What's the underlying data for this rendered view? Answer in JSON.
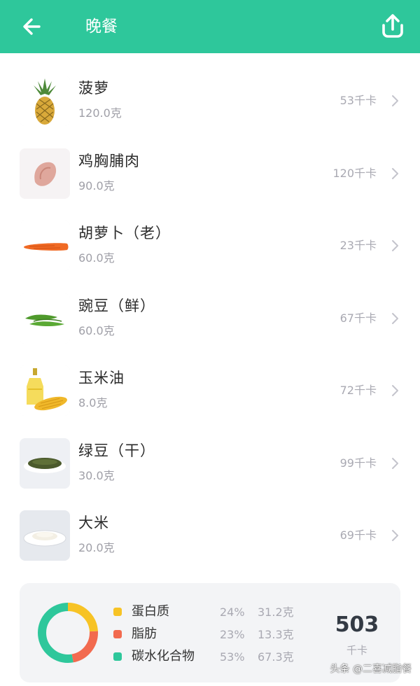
{
  "header": {
    "title": "晚餐",
    "bg_color": "#2ec79b",
    "back_icon": "arrow-left-icon",
    "share_icon": "share-upload-icon"
  },
  "foods": [
    {
      "name": "菠萝",
      "amount": "120.0克",
      "kcal": "53千卡",
      "image": "pineapple"
    },
    {
      "name": "鸡胸脯肉",
      "amount": "90.0克",
      "kcal": "120千卡",
      "image": "chicken-breast"
    },
    {
      "name": "胡萝卜（老）",
      "amount": "60.0克",
      "kcal": "23千卡",
      "image": "carrot"
    },
    {
      "name": "豌豆（鲜）",
      "amount": "60.0克",
      "kcal": "67千卡",
      "image": "peas"
    },
    {
      "name": "玉米油",
      "amount": "8.0克",
      "kcal": "72千卡",
      "image": "corn-oil"
    },
    {
      "name": "绿豆（干）",
      "amount": "30.0克",
      "kcal": "99千卡",
      "image": "mung-beans"
    },
    {
      "name": "大米",
      "amount": "20.0克",
      "kcal": "69千卡",
      "image": "rice"
    }
  ],
  "summary": {
    "nutrients": [
      {
        "name": "蛋白质",
        "percent": "24%",
        "amount": "31.2克",
        "color": "#f7c325",
        "share": 0.24
      },
      {
        "name": "脂肪",
        "percent": "23%",
        "amount": "13.3克",
        "color": "#f26a4f",
        "share": 0.23
      },
      {
        "name": "碳水化合物",
        "percent": "53%",
        "amount": "67.3克",
        "color": "#2ec79b",
        "share": 0.53
      }
    ],
    "total": "503",
    "total_unit": "千卡"
  },
  "watermark": "头条 @二喜减脂餐"
}
